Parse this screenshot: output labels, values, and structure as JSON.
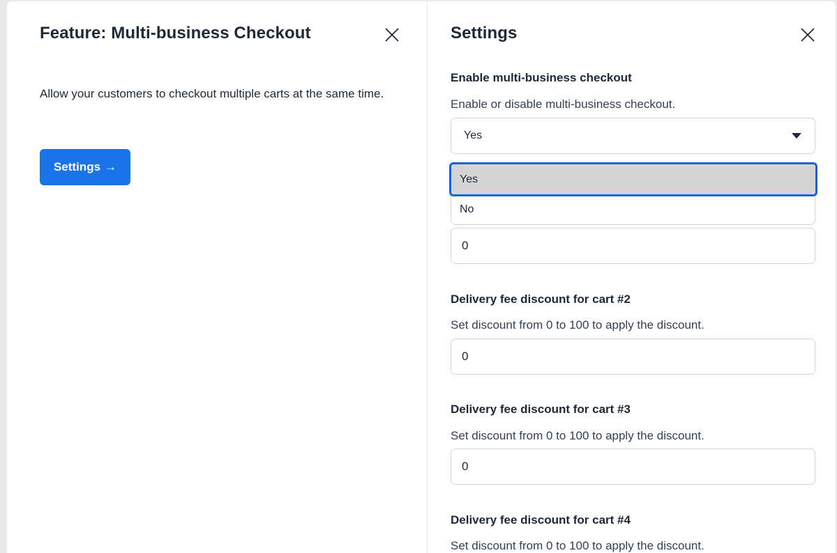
{
  "feature_panel": {
    "title": "Feature: Multi-business Checkout",
    "description": "Allow your customers to checkout multiple carts at the same time.",
    "settings_button": "Settings",
    "settings_arrow": "→"
  },
  "settings_panel": {
    "title": "Settings",
    "enable_field": {
      "label": "Enable multi-business checkout",
      "help": "Enable or disable multi-business checkout.",
      "selected_value": "Yes",
      "options": [
        "Yes",
        "No"
      ],
      "highlighted_option": "Yes"
    },
    "cart1_discount_value": "0",
    "cart2": {
      "label": "Delivery fee discount for cart #2",
      "help": "Set discount from 0 to 100 to apply the discount.",
      "value": "0"
    },
    "cart3": {
      "label": "Delivery fee discount for cart #3",
      "help": "Set discount from 0 to 100 to apply the discount.",
      "value": "0"
    },
    "cart4": {
      "label": "Delivery fee discount for cart #4",
      "help": "Set discount from 0 to 100 to apply the discount."
    }
  },
  "colors": {
    "primary": "#1a73e8",
    "focus_ring": "#1a62d8",
    "highlight_bg": "#d5d5d5"
  },
  "icons": {
    "close": "close-icon",
    "dropdown": "chevron-down-icon"
  }
}
